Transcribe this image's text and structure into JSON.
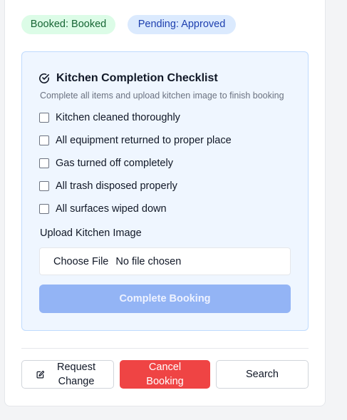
{
  "badges": {
    "booked": "Booked: Booked",
    "pending": "Pending: Approved"
  },
  "checklist": {
    "title": "Kitchen Completion Checklist",
    "subtitle": "Complete all items and upload kitchen image to finish booking",
    "items": [
      {
        "label": "Kitchen cleaned thoroughly",
        "checked": false
      },
      {
        "label": "All equipment returned to proper place",
        "checked": false
      },
      {
        "label": "Gas turned off completely",
        "checked": false
      },
      {
        "label": "All trash disposed properly",
        "checked": false
      },
      {
        "label": "All surfaces wiped down",
        "checked": false
      }
    ],
    "upload_label": "Upload Kitchen Image",
    "file_button": "Choose File",
    "file_status": "No file chosen",
    "complete_button": "Complete Booking"
  },
  "actions": {
    "request_change": "Request Change",
    "cancel_booking": "Cancel Booking",
    "search": "Search"
  },
  "colors": {
    "booked_bg": "#dcfce7",
    "pending_bg": "#dbeafe",
    "panel_bg": "#eff6ff",
    "complete_button_disabled": "#93b4f5",
    "cancel_button": "#ef4444"
  },
  "icons": {
    "title_icon": "check-circle-icon",
    "request_icon": "edit-icon"
  }
}
